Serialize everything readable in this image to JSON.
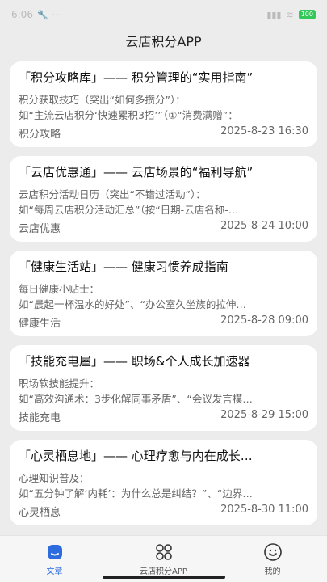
{
  "status_bar": {
    "time": "6:06",
    "battery": "100"
  },
  "app_title": "云店积分APP",
  "cards": [
    {
      "title": "「积分攻略库」—— 积分管理的“实用指南”",
      "line1": "积分获取技巧（突出“如何多攒分”）：",
      "line2": "如“主流云店积分‘快速累积3招’”（①“消费满赠”：",
      "category": "积分攻略",
      "date": "2025-8-23 16:30"
    },
    {
      "title": "「云店优惠通」—— 云店场景的“福利导航”",
      "line1": "云店积分活动日历（突出“不错过活动”）：",
      "line2": "如“每周云店积分活动汇总”（按“日期-云店名称-…",
      "category": "云店优惠",
      "date": "2025-8-24 10:00"
    },
    {
      "title": "「健康生活站」—— 健康习惯养成指南",
      "line1": "每日健康小贴士：",
      "line2": "如“晨起一杯温水的好处”、“办公室久坐族的拉伸…",
      "category": "健康生活",
      "date": "2025-8-28 09:00"
    },
    {
      "title": "「技能充电屋」—— 职场&个人成长加速器",
      "line1": "职场软技能提升：",
      "line2": "如“高效沟通术：3步化解同事矛盾”、“会议发言模…",
      "category": "技能充电",
      "date": "2025-8-29 15:00"
    },
    {
      "title": "「心灵栖息地」—— 心理疗愈与内在成长…",
      "line1": "心理知识普及：",
      "line2": "如“五分钟了解‘内耗’：为什么总是纠结？”、“边界…",
      "category": "心灵栖息",
      "date": "2025-8-30 11:00"
    }
  ],
  "tabs": [
    {
      "label": "文章",
      "icon": "article-icon",
      "active": true
    },
    {
      "label": "云店积分APP",
      "icon": "grid-icon",
      "active": false
    },
    {
      "label": "我的",
      "icon": "smile-icon",
      "active": false
    }
  ],
  "colors": {
    "accent": "#2d6cdf",
    "background": "#ececec",
    "card": "#ffffff"
  }
}
